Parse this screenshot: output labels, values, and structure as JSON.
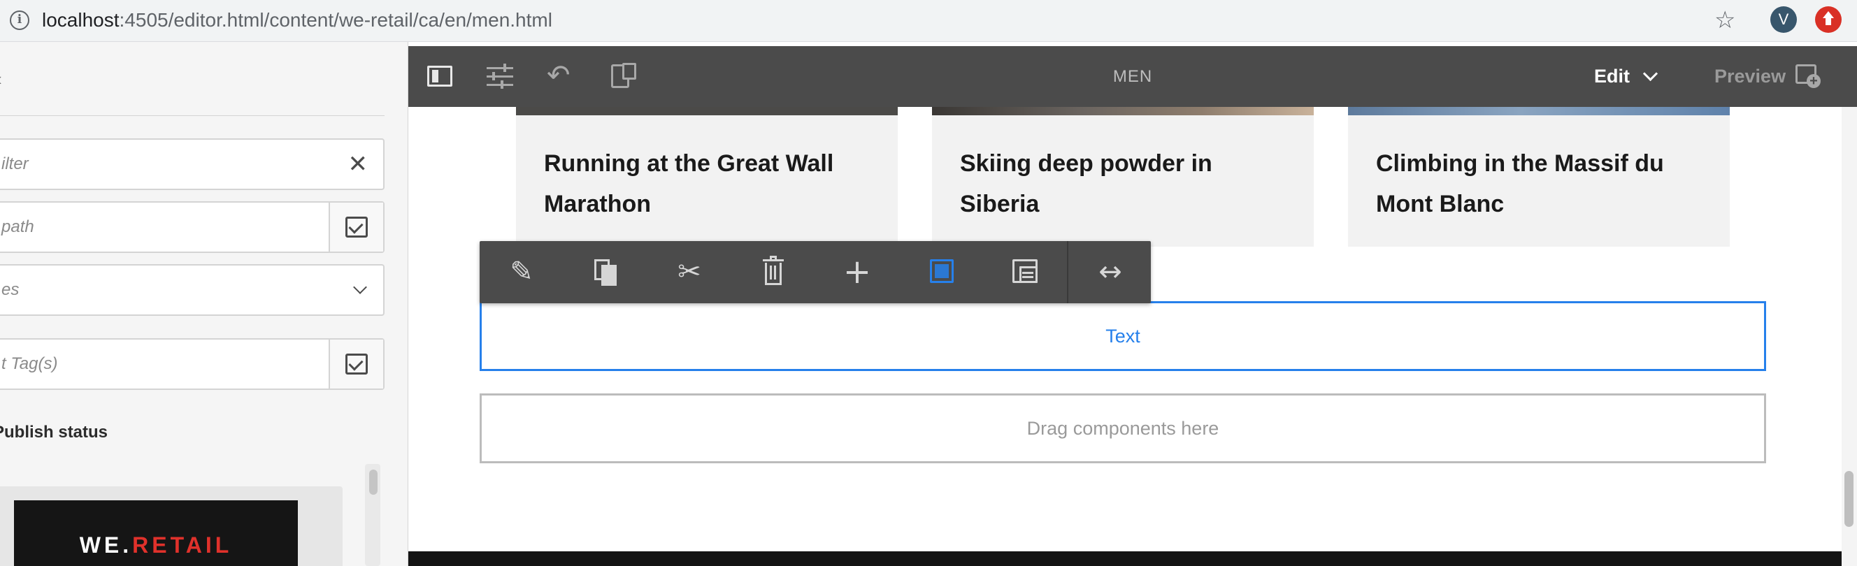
{
  "browser": {
    "url_host": "localhost",
    "url_path": ":4505/editor.html/content/we-retail/ca/en/men.html",
    "avatar_letter": "V"
  },
  "sidepanel": {
    "filter_placeholder": "ilter",
    "path_placeholder": "path",
    "types_placeholder": "es",
    "tags_placeholder": "t Tag(s)",
    "publish_status_label": "Publish status",
    "asset_logo_white": "WE.",
    "asset_logo_red": "RETAIL"
  },
  "editor_toolbar": {
    "page_title": "MEN",
    "mode_label": "Edit",
    "preview_label": "Preview"
  },
  "cards": [
    {
      "title": "Running at the Great Wall Marathon"
    },
    {
      "title": "Skiing deep powder in Siberia"
    },
    {
      "title": "Climbing in the Massif du Mont Blanc"
    }
  ],
  "component_toolbar": {
    "actions": [
      "edit-icon",
      "copy-icon",
      "cut-icon",
      "delete-icon",
      "insert-icon",
      "group-icon",
      "parent-icon",
      "layout-icon"
    ],
    "active_action": "group-icon"
  },
  "components": {
    "text_label": "Text",
    "drop_zone_label": "Drag components here"
  },
  "colors": {
    "accent": "#2680eb",
    "toolbar_bg": "#4b4b4b"
  }
}
